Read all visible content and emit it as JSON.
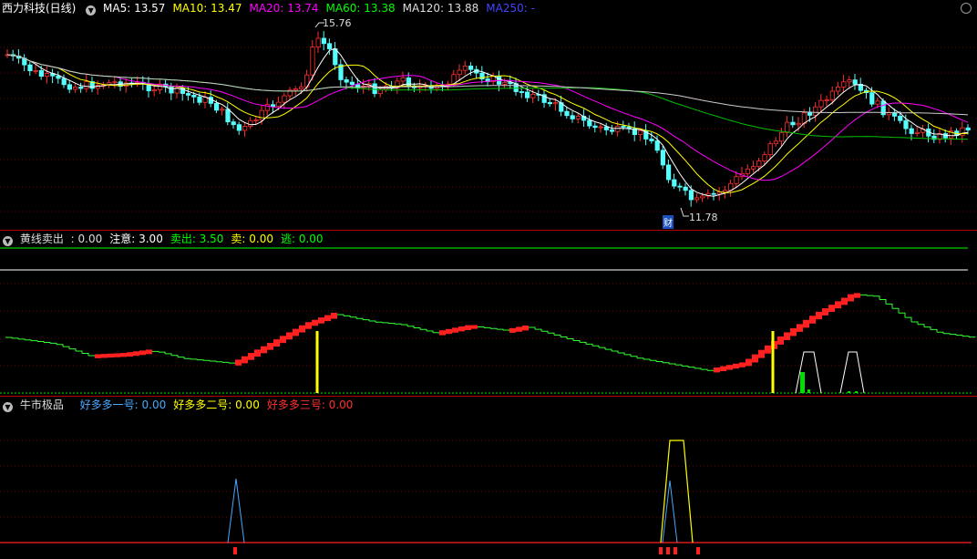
{
  "main": {
    "title": "西力科技(日线)",
    "ma": [
      {
        "label": "MA5: 13.57",
        "color": "#ffffff"
      },
      {
        "label": "MA10: 13.47",
        "color": "#ffff00"
      },
      {
        "label": "MA20: 13.74",
        "color": "#ff00ff"
      },
      {
        "label": "MA60: 13.38",
        "color": "#00ff00"
      },
      {
        "label": "MA120: 13.88",
        "color": "#dddddd"
      },
      {
        "label": "MA250: -",
        "color": "#4444ff"
      }
    ],
    "high_label": "15.76",
    "low_label": "11.78",
    "badge": "财",
    "colors": {
      "up": "#ff3030",
      "down": "#54ffff"
    }
  },
  "ind1": {
    "name": "黄线卖出",
    "values": [
      {
        "label": ": 0.00",
        "color": "#dddddd"
      },
      {
        "label": "注意: 3.00",
        "color": "#ffffff"
      },
      {
        "label": "卖出: 3.50",
        "color": "#00ff00"
      },
      {
        "label": "卖: 0.00",
        "color": "#ffff00"
      },
      {
        "label": "逃: 0.00",
        "color": "#00ff00"
      }
    ]
  },
  "ind2": {
    "name": "牛市极品",
    "values": [
      {
        "label": "好多多一号: 0.00",
        "color": "#4aa8ff"
      },
      {
        "label": "好多多二号: 0.00",
        "color": "#ffff00"
      },
      {
        "label": "好多多三号: 0.00",
        "color": "#ff3030"
      }
    ]
  }
}
